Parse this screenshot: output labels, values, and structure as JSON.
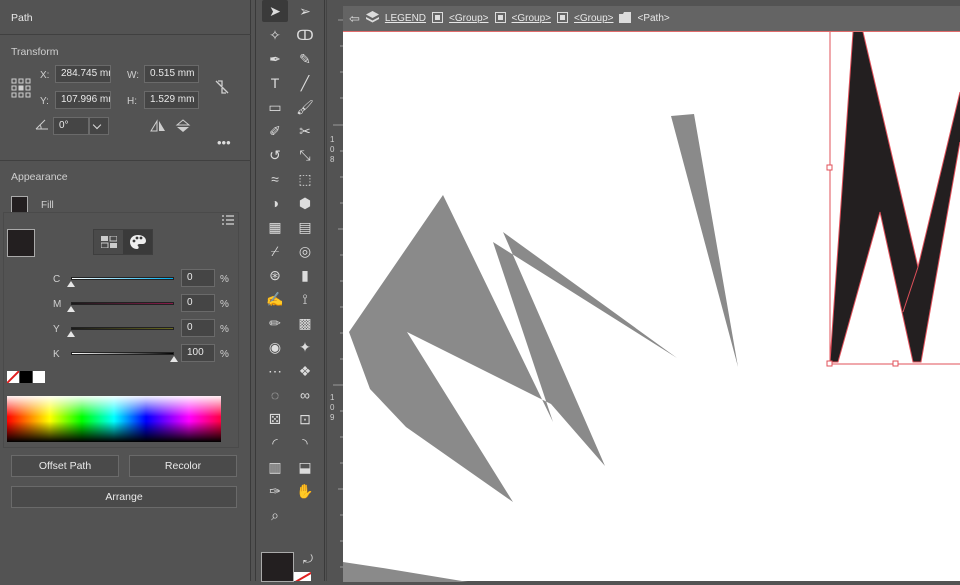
{
  "properties": {
    "path_title": "Path",
    "transform_title": "Transform",
    "x_label": "X:",
    "x_value": "284.745 mr",
    "y_label": "Y:",
    "y_value": "107.996 mr",
    "w_label": "W:",
    "w_value": "0.515 mm",
    "h_label": "H:",
    "h_value": "1.529 mm",
    "angle_value": "0°",
    "appearance_title": "Appearance",
    "fill_label": "Fill",
    "cmyk": [
      {
        "label": "C",
        "value": "0",
        "unit": "%",
        "level": 0
      },
      {
        "label": "M",
        "value": "0",
        "unit": "%",
        "level": 0
      },
      {
        "label": "Y",
        "value": "0",
        "unit": "%",
        "level": 0
      },
      {
        "label": "K",
        "value": "100",
        "unit": "%",
        "level": 1
      }
    ],
    "offset_path_label": "Offset Path",
    "recolor_label": "Recolor",
    "arrange_label": "Arrange"
  },
  "breadcrumb": {
    "items": [
      "LEGEND",
      "<Group>",
      "<Group>",
      "<Group>",
      "<Path>"
    ]
  },
  "rulers": {
    "v_label_1": "108",
    "v_label_2": "109"
  },
  "colors": {
    "panel": "#535353",
    "canvas": "#ffffff",
    "selection": "#e0505a",
    "fill_swatch": "#231f20",
    "shape_gray": "#8a8a8a"
  },
  "tool_icons": [
    "selection-icon",
    "direct-selection-icon",
    "magic-wand-icon",
    "lasso-icon",
    "pen-icon",
    "curvature-icon",
    "type-icon",
    "line-icon",
    "rectangle-icon",
    "paintbrush-icon",
    "shaper-icon",
    "scissors-icon",
    "rotate-icon",
    "scale-icon",
    "width-icon",
    "free-transform-icon",
    "shape-builder-icon",
    "live-paint-icon",
    "mesh-icon",
    "gradient-icon",
    "eyedropper-icon",
    "blend-icon",
    "symbol-sprayer-icon",
    "column-graph-icon",
    "artboard-icon",
    "slice-icon",
    "eraser-icon",
    "knife-icon",
    "warp-icon",
    "puppet-warp-icon",
    "pattern-icon",
    "artboard-tool-icon",
    "perspective-grid-icon",
    "perspective-selection-icon",
    "dice-icon",
    "crop-icon",
    "mesh-gradient-icon",
    "measure-icon",
    "ruler-icon",
    "print-tiling-icon",
    "pucker-icon",
    "hand-icon",
    "zoom-icon"
  ]
}
